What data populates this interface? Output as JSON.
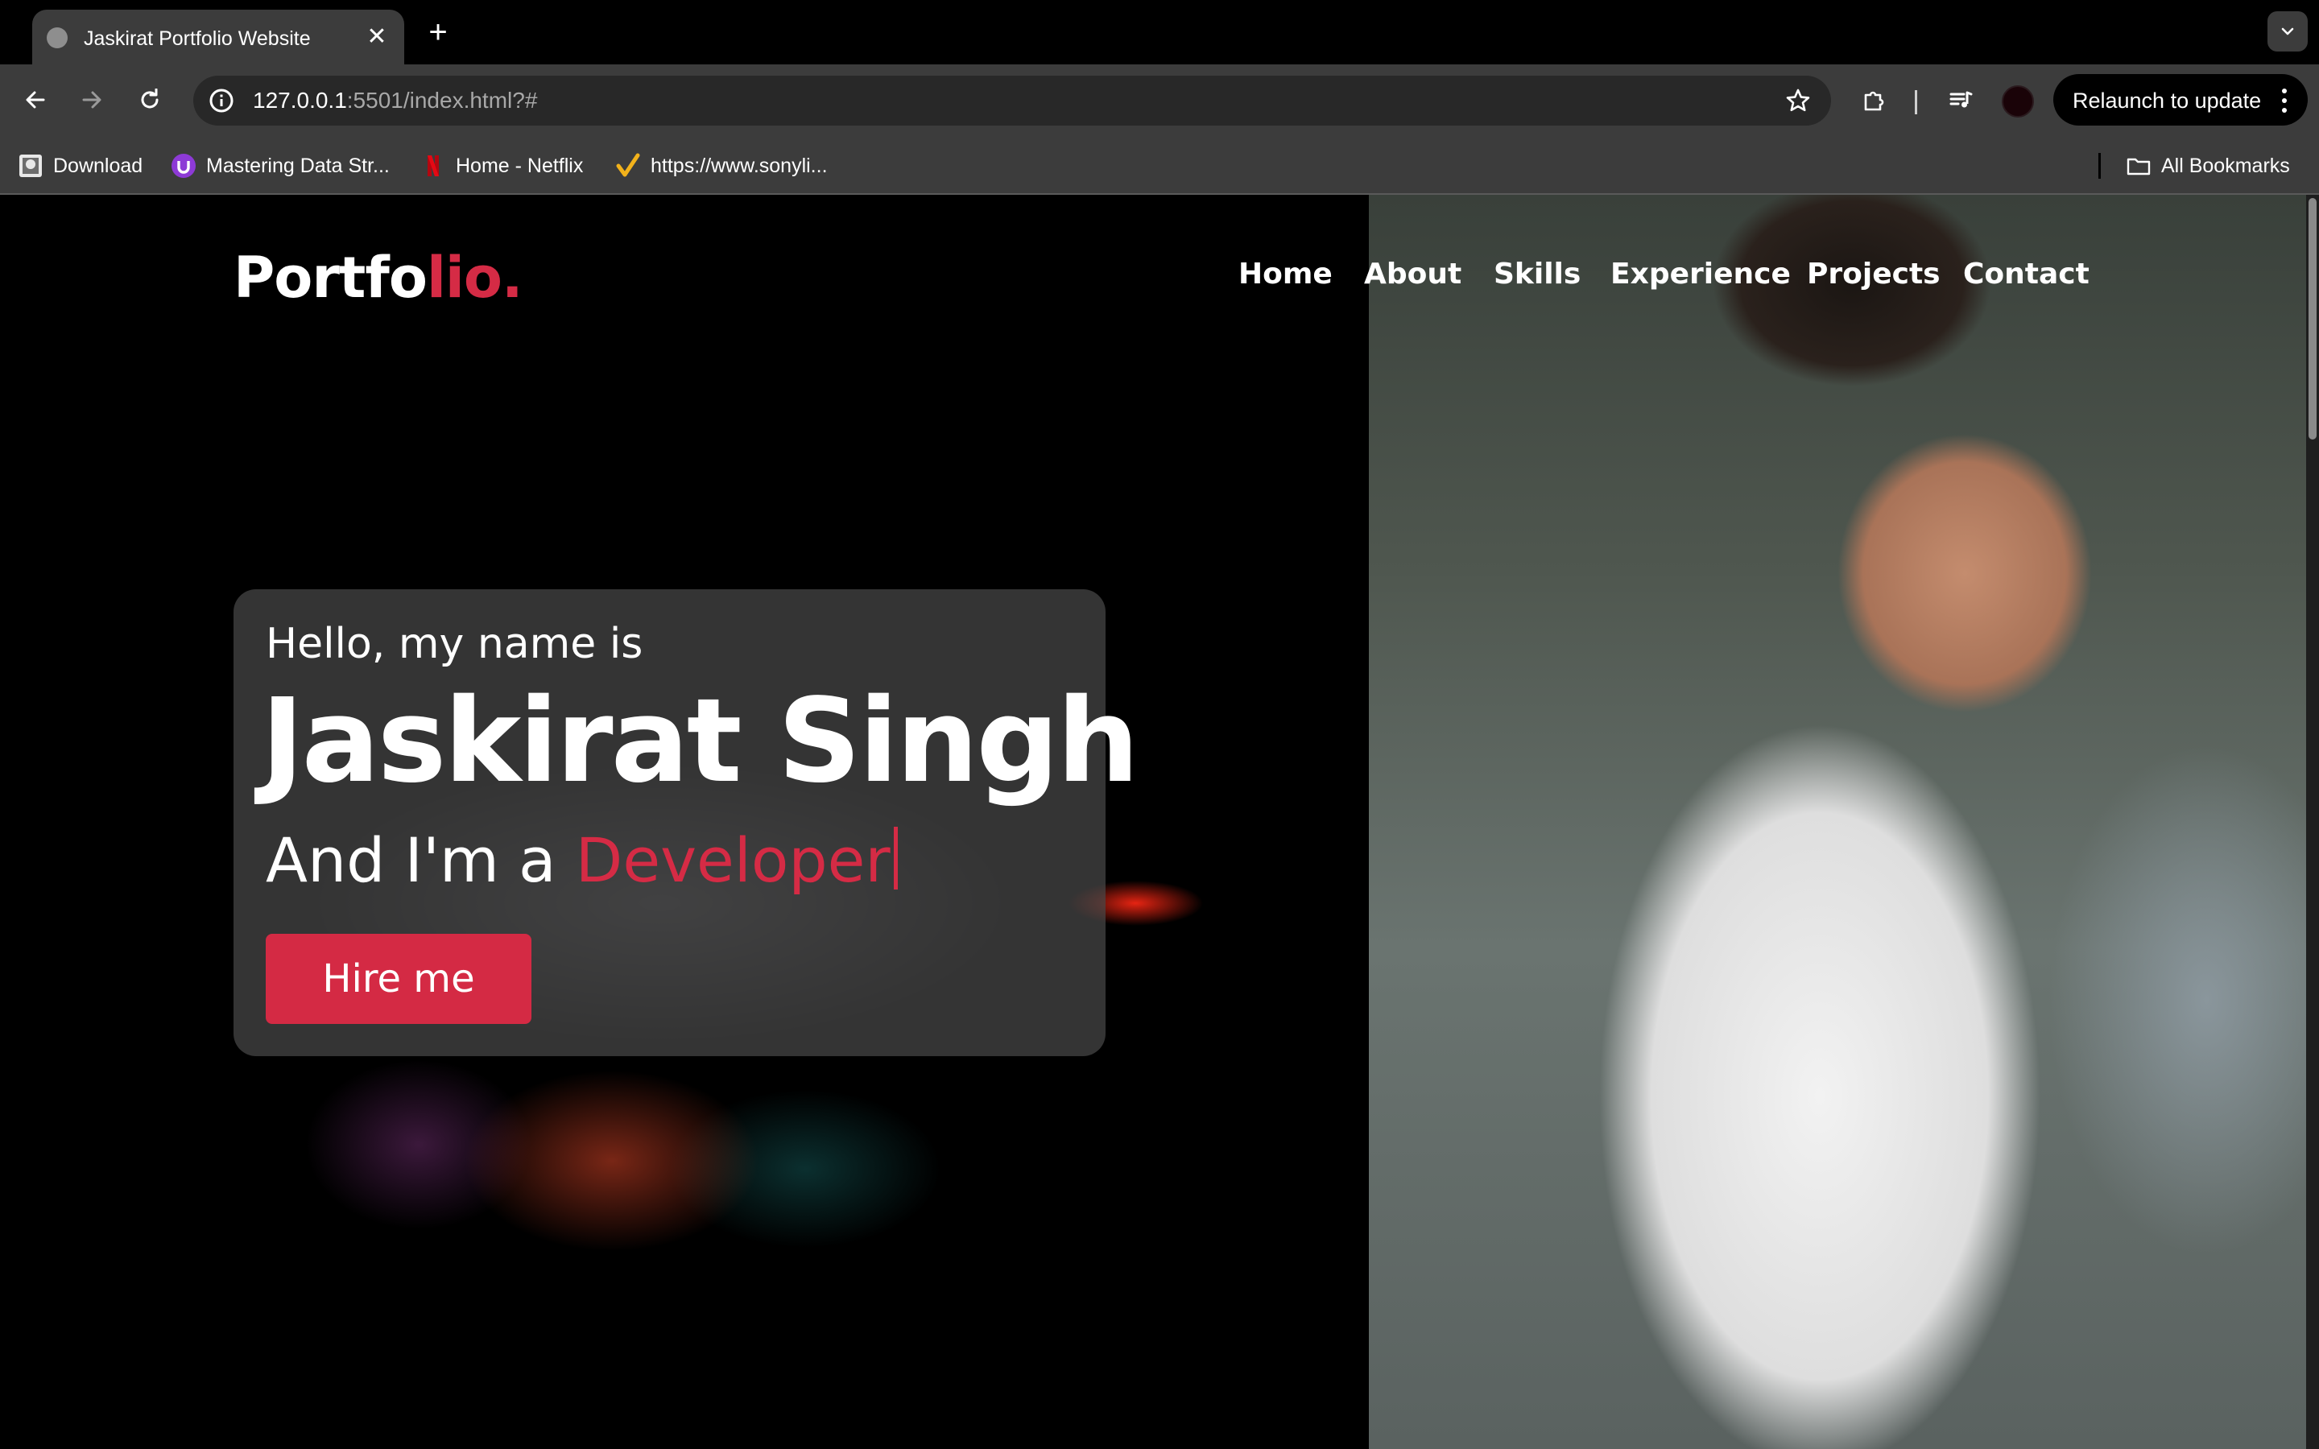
{
  "browser": {
    "tab": {
      "title": "Jaskirat Portfolio Website",
      "favicon": "globe-icon",
      "close_glyph": "✕"
    },
    "new_tab_glyph": "+",
    "address": {
      "host": "127.0.0.1",
      "rest": ":5501/index.html?#"
    },
    "relaunch_label": "Relaunch to update",
    "bookmarks": [
      {
        "label": "Download",
        "icon": "download-favicon-icon"
      },
      {
        "label": "Mastering Data Str...",
        "icon": "udemy-favicon-icon"
      },
      {
        "label": "Home - Netflix",
        "icon": "netflix-favicon-icon"
      },
      {
        "label": "https://www.sonyli...",
        "icon": "check-favicon-icon"
      }
    ],
    "all_bookmarks_label": "All Bookmarks"
  },
  "site": {
    "logo": {
      "main": "Portfo",
      "accent": "lio."
    },
    "nav": [
      "Home",
      "About",
      "Skills",
      "Experience",
      "Projects",
      "Contact"
    ],
    "hero": {
      "greeting": "Hello, my name is",
      "name": "Jaskirat Singh",
      "role_prefix": "And I'm a ",
      "role_word": "Developer",
      "cta": "Hire me"
    }
  },
  "colors": {
    "accent": "#d52b45",
    "chrome_bg": "#3c3c3c",
    "omnibox_bg": "#282828",
    "page_bg": "#000000"
  }
}
